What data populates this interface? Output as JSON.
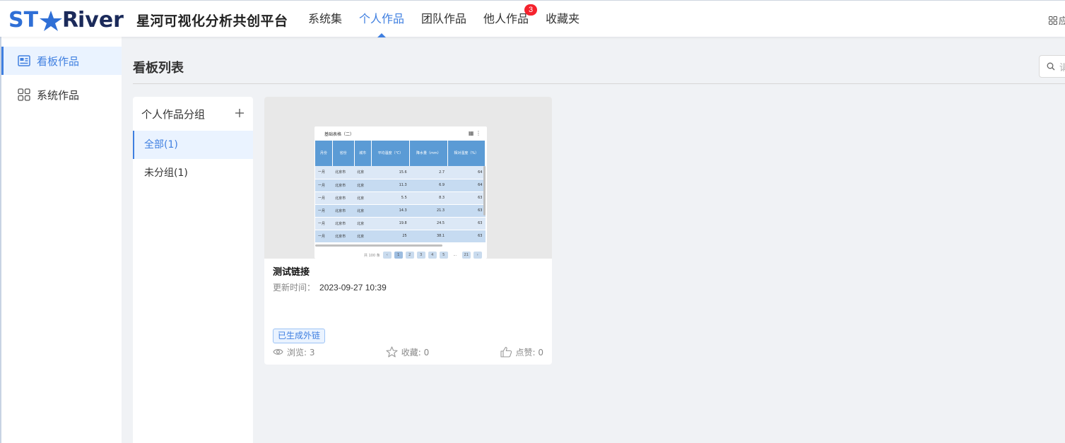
{
  "header": {
    "brand": "STRiver",
    "app_title": "星河可视化分析共创平台",
    "nav": [
      {
        "label": "系统集"
      },
      {
        "label": "个人作品",
        "active": true
      },
      {
        "label": "团队作品"
      },
      {
        "label": "他人作品",
        "badge": "3"
      },
      {
        "label": "收藏夹"
      }
    ],
    "right_label": "应用"
  },
  "sidebar": {
    "items": [
      {
        "label": "看板作品",
        "icon": "dashboard-icon",
        "active": true
      },
      {
        "label": "系统作品",
        "icon": "grid-icon"
      }
    ]
  },
  "main": {
    "title": "看板列表",
    "search_placeholder": "请输入"
  },
  "groups": {
    "title": "个人作品分组",
    "add_icon": "plus-icon",
    "items": [
      {
        "label": "全部(1)",
        "active": true
      },
      {
        "label": "未分组(1)"
      }
    ]
  },
  "card": {
    "title": "测试链接",
    "time_label": "更新时间：",
    "time_value": "2023-09-27 10:39",
    "tag": "已生成外链",
    "views": "浏览: 3",
    "favorites": "收藏: 0",
    "likes": "点赞: 0",
    "preview": {
      "title": "基础表格（二）",
      "headers": [
        "月份",
        "省份",
        "城市",
        "平均温度（℃）",
        "降水量（mm）",
        "相对湿度（%）"
      ],
      "rows": [
        [
          "一月",
          "北京市",
          "北京",
          "15.6",
          "2.7",
          "64"
        ],
        [
          "一月",
          "北京市",
          "北京",
          "11.3",
          "6.9",
          "64"
        ],
        [
          "一月",
          "北京市",
          "北京",
          "5.5",
          "8.3",
          "63"
        ],
        [
          "一月",
          "北京市",
          "北京",
          "14.3",
          "21.3",
          "63"
        ],
        [
          "一月",
          "北京市",
          "北京",
          "19.8",
          "24.5",
          "63"
        ],
        [
          "一月",
          "北京市",
          "北京",
          "25",
          "38.1",
          "63"
        ]
      ],
      "pager": {
        "total": "共 100 条",
        "pages": [
          "1",
          "2",
          "3",
          "4",
          "5",
          "...",
          "21"
        ]
      }
    }
  },
  "colors": {
    "accent": "#3f7fe0",
    "badge": "#f5222d",
    "table_header": "#5b9bd5"
  }
}
